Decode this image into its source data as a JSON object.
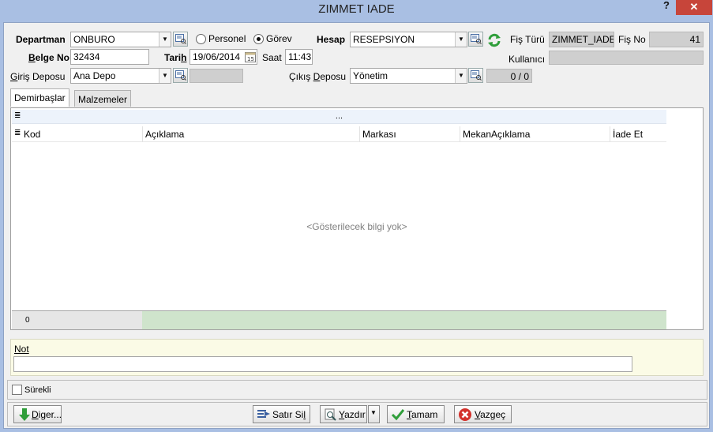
{
  "window": {
    "title": "ZIMMET IADE",
    "help_label": "?",
    "close_label": "✕"
  },
  "form": {
    "departman": {
      "label": "Departman",
      "value": "ONBURO"
    },
    "radio_personel": {
      "label": "Personel",
      "selected": false
    },
    "radio_gorev": {
      "label": "Görev",
      "selected": true
    },
    "hesap": {
      "label": "Hesap",
      "value": "RESEPSIYON"
    },
    "fis_turu": {
      "label": "Fiş Türü",
      "value": "ZIMMET_IADE"
    },
    "fis_no": {
      "label": "Fiş No",
      "value": "41"
    },
    "belge_no": {
      "label": "Belge No",
      "value": "32434"
    },
    "tarih": {
      "label_pre": "Tari",
      "label_key": "h",
      "value": "19/06/2014"
    },
    "saat": {
      "label": "Saat",
      "value": "11:43"
    },
    "kullanici": {
      "label": "Kullanıcı",
      "value": ""
    },
    "giris_deposu": {
      "label_key": "G",
      "label_rest": "iriş Deposu",
      "value": "Ana Depo",
      "extra": ""
    },
    "cikis_deposu": {
      "label_pre": "Çıkış ",
      "label_key": "D",
      "label_rest": "eposu",
      "value": "Yönetim",
      "count": "0 / 0"
    }
  },
  "tabs": [
    {
      "label": "Demirbaşlar",
      "active": true
    },
    {
      "label": "Malzemeler",
      "active": false
    }
  ],
  "grid": {
    "group_row_text": "...",
    "columns": [
      "Kod",
      "Açıklama",
      "Markası",
      "MekanAçıklama",
      "İade Et"
    ],
    "empty_text": "<Gösterilecek bilgi yok>",
    "footer_count": "0"
  },
  "not": {
    "label": "Not",
    "value": ""
  },
  "surekli": {
    "label": "Sürekli",
    "checked": false
  },
  "buttons": {
    "diger": {
      "key": "D",
      "rest": "iger..."
    },
    "satir_sil": {
      "pre": "Satır Si",
      "key": "l"
    },
    "yazdir": {
      "key": "Y",
      "rest": "azdır"
    },
    "tamam": {
      "key": "T",
      "rest": "amam"
    },
    "vazgec": {
      "key": "V",
      "rest": "azgeç"
    }
  },
  "colors": {
    "accent_title": "#a9bfe3",
    "close": "#c7453a",
    "grid_footer": "#cfe4cc"
  }
}
